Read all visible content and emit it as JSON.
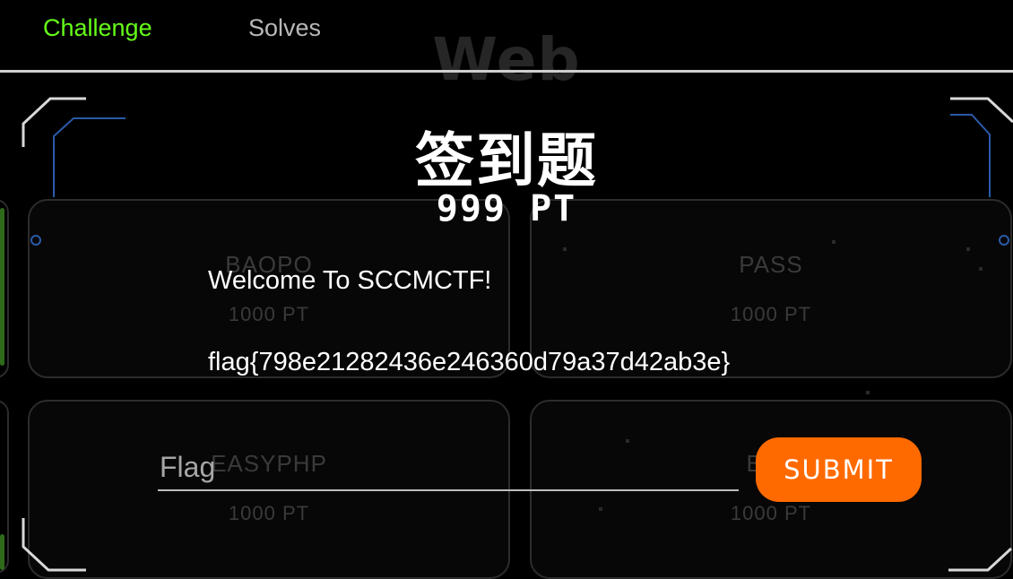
{
  "nav": {
    "tabs": [
      {
        "label": "Challenge",
        "active": true
      },
      {
        "label": "Solves",
        "active": false
      }
    ]
  },
  "background": {
    "category": "Web",
    "cards": [
      {
        "name": "BAOPO",
        "points": "1000 PT"
      },
      {
        "name": "PASS",
        "points": "1000 PT"
      },
      {
        "name": "EASYPHP",
        "points": "1000 PT"
      },
      {
        "name": "BAB",
        "points": "1000 PT"
      }
    ]
  },
  "challenge": {
    "title": "签到题",
    "points": "999 PT",
    "description": "Welcome To SCCMCTF!",
    "flag_text": "flag{798e21282436e246360d79a37d42ab3e}"
  },
  "form": {
    "flag_placeholder": "Flag",
    "submit_label": "SUBMIT"
  },
  "colors": {
    "active_tab": "#66ff1a",
    "submit": "#ff6a00",
    "frame_accent": "#2b5aa8"
  }
}
